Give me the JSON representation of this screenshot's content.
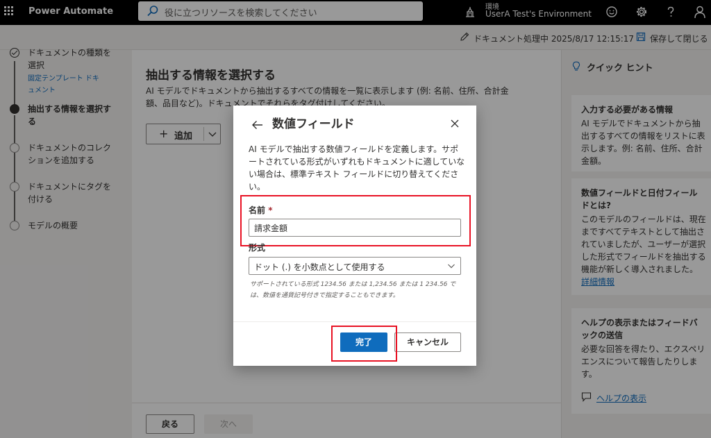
{
  "topbar": {
    "app_name": "Power Automate",
    "search_placeholder": "役に立つリソースを検索してください",
    "env_label": "環境",
    "env_name": "UserA Test's Environment"
  },
  "cmdbar": {
    "status": "ドキュメント処理中 2025/8/17 12:15:17",
    "save_close": "保存して閉じる"
  },
  "steps": [
    {
      "label": "ドキュメントの種類を選択",
      "sublabel": "固定テンプレート ドキュメント",
      "state": "done"
    },
    {
      "label": "抽出する情報を選択する",
      "state": "current"
    },
    {
      "label": "ドキュメントのコレクションを追加する",
      "state": "pending"
    },
    {
      "label": "ドキュメントにタグを付ける",
      "state": "pending"
    },
    {
      "label": "モデルの概要",
      "state": "pending"
    }
  ],
  "main": {
    "title": "抽出する情報を選択する",
    "description": "AI モデルでドキュメントから抽出するすべての情報を一覧に表示します (例: 名前、住所、合計金額、品目など)。ドキュメントでそれらをタグ付けしてください。",
    "add_label": "追加",
    "back_label": "戻る",
    "next_label": "次へ"
  },
  "hints": {
    "title": "クイック ヒント",
    "cards": [
      {
        "title": "入力する必要がある情報",
        "body": "AI モデルでドキュメントから抽出するすべての情報をリストに表示します。例: 名前、住所、合計金額。"
      },
      {
        "title": "数値フィールドと日付フィールドとは?",
        "body": "このモデルのフィールドは、現在まですべてテキストとして抽出されていましたが、ユーザーが選択した形式でフィールドを抽出する機能が新しく導入されました。",
        "link": "詳細情報"
      },
      {
        "title": "ヘルプの表示またはフィードバックの送信",
        "body": "必要な回答を得たり、エクスペリエンスについて報告したりします。"
      }
    ],
    "help_link": "ヘルプの表示"
  },
  "dialog": {
    "title": "数値フィールド",
    "description": "AI モデルで抽出する数値フィールドを定義します。サポートされている形式がいずれもドキュメントに適していない場合は、標準テキスト フィールドに切り替えてください。",
    "name_label": "名前",
    "required_mark": "*",
    "name_value": "請求金額",
    "format_label": "形式",
    "format_value": "ドット (.) を小数点として使用する",
    "format_hint": "サポートされている形式 1234.56 または 1,234.56 または 1 234.56 では、数値を通貨記号付きで指定することもできます。",
    "done_label": "完了",
    "cancel_label": "キャンセル"
  },
  "colors": {
    "accent": "#0f6cbd",
    "highlight": "#e81123"
  }
}
